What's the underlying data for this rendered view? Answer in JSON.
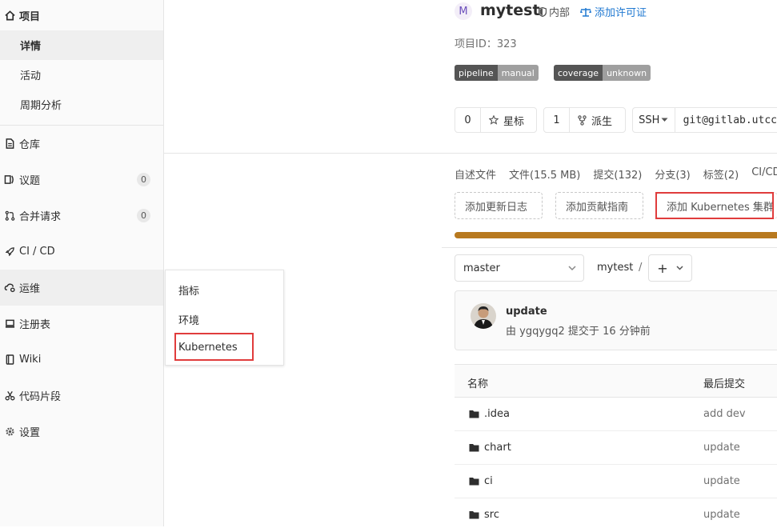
{
  "sidebar": {
    "project": "项目",
    "details": "详情",
    "activity": "活动",
    "cycle": "周期分析",
    "repo": "仓库",
    "issues": "议题",
    "issues_count": "0",
    "mrs": "合并请求",
    "mrs_count": "0",
    "cicd": "CI / CD",
    "ops": "运维",
    "registry": "注册表",
    "wiki": "Wiki",
    "snippets": "代码片段",
    "settings": "设置"
  },
  "flyout": {
    "metrics": "指标",
    "environments": "环境",
    "kubernetes": "Kubernetes"
  },
  "project": {
    "avatar_letter": "M",
    "name": "mytest",
    "visibility": "内部",
    "add_license": "添加许可证",
    "id_text": "项目ID：323"
  },
  "badges": [
    {
      "left": "pipeline",
      "right": "manual"
    },
    {
      "left": "coverage",
      "right": "unknown"
    }
  ],
  "actions": {
    "star_count": "0",
    "star_label": "星标",
    "fork_count": "1",
    "fork_label": "派生",
    "protocol": "SSH",
    "clone_url": "git@gitlab.utcc"
  },
  "stats": [
    "自述文件",
    "文件(15.5 MB)",
    "提交(132)",
    "分支(3)",
    "标签(2)",
    "CI/CD"
  ],
  "quick_buttons": {
    "changelog": "添加更新日志",
    "contributing": "添加贡献指南",
    "kubernetes": "添加 Kubernetes 集群"
  },
  "repo": {
    "branch": "master",
    "crumb": "mytest",
    "slash": "/",
    "plus": "+"
  },
  "commit": {
    "title": "update",
    "byline": "由 ygqygq2 提交于 16 分钟前"
  },
  "table": {
    "col_name": "名称",
    "col_last": "最后提交",
    "rows": [
      {
        "name": ".idea",
        "last": "add dev"
      },
      {
        "name": "chart",
        "last": "update"
      },
      {
        "name": "ci",
        "last": "update"
      },
      {
        "name": "src",
        "last": "update"
      }
    ]
  },
  "colors": {
    "accent": "#1f78d1",
    "highlight": "#e03c3c",
    "progress": "#b8791f"
  }
}
